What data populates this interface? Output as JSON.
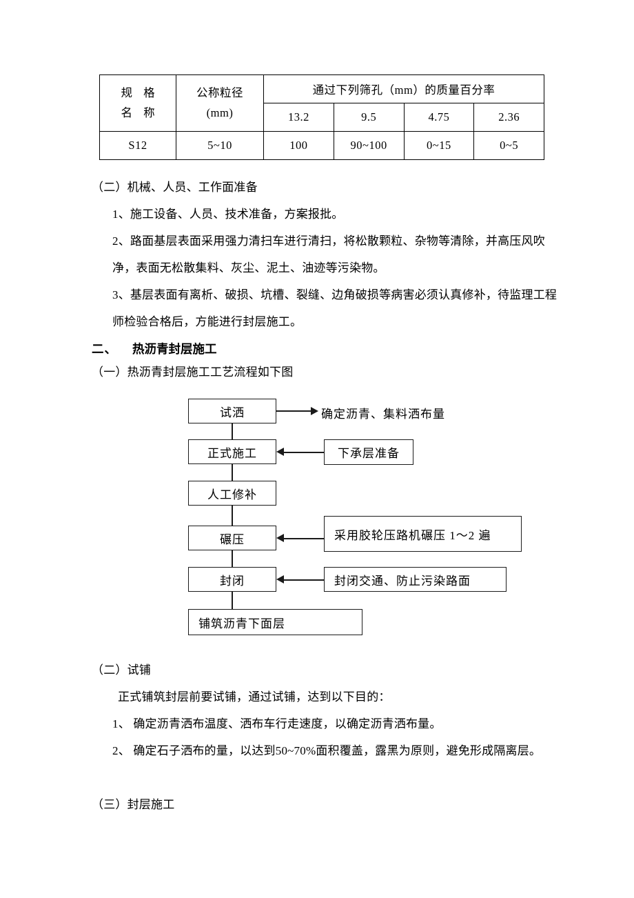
{
  "document": {
    "language": "zh-CN",
    "page_background": "#ffffff",
    "text_color": "#000000"
  },
  "spec_table": {
    "stub_header": {
      "line1": "规 格",
      "line2": "名 称"
    },
    "nominal_header": {
      "line1": "公称粒径",
      "line2": "(mm)"
    },
    "group_header": "通过下列筛孔（mm）的质量百分率",
    "sieve_columns": [
      "13.2",
      "9.5",
      "4.75",
      "2.36"
    ],
    "rows": [
      {
        "grade_name": "S12",
        "nominal_size": "5~10",
        "values": [
          "100",
          "90~100",
          "0~15",
          "0~5"
        ]
      }
    ]
  },
  "section_two_prep": {
    "heading": "（二）机械、人员、工作面准备",
    "items": [
      "1、施工设备、人员、技术准备，方案报批。",
      "2、路面基层表面采用强力清扫车进行清扫，将松散颗粒、杂物等清除，并高压风吹净，表面无松散集料、灰尘、泥土、油迹等污染物。",
      "3、基层表面有离析、破损、坑槽、裂缝、边角破损等病害必须认真修补，待监理工程师检验合格后，方能进行封层施工。"
    ]
  },
  "chapter_two": {
    "number": "二、",
    "title": "热沥青封层施工"
  },
  "flow_section": {
    "heading": "（一）热沥青封层施工工艺流程如下图"
  },
  "flowchart": {
    "main_steps": [
      "试洒",
      "正式施工",
      "人工修补",
      "碾压",
      "封闭",
      "铺筑沥青下面层"
    ],
    "side_notes": {
      "trial_spray_output": "确定沥青、集料洒布量",
      "subbase_prep": "下承层准备",
      "rolling_note": "采用胶轮压路机碾压 1～2 遍",
      "closure_note": "封闭交通、防止污染路面"
    }
  },
  "section_trial_paving": {
    "heading": "（二）试铺",
    "intro": "正式铺筑封层前要试铺，通过试铺，达到以下目的：",
    "items": [
      "1、 确定沥青洒布温度、洒布车行走速度，以确定沥青洒布量。",
      "2、 确定石子洒布的量，以达到50~70%面积覆盖，露黑为原则，避免形成隔离层。"
    ]
  },
  "section_seal_construction": {
    "heading": "（三）封层施工"
  }
}
